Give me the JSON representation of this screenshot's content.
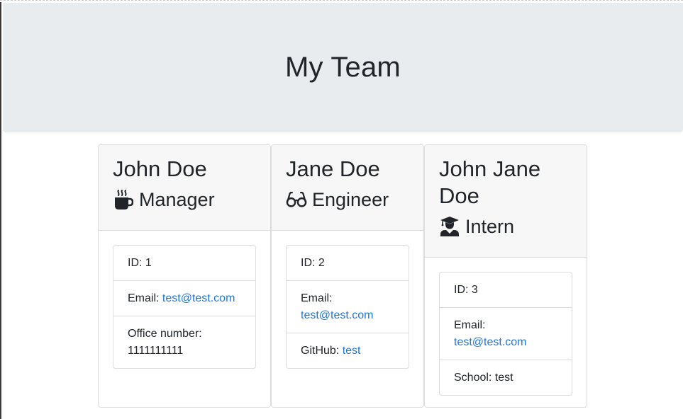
{
  "header": {
    "title": "My Team"
  },
  "employees": [
    {
      "name": "John Doe",
      "role": "Manager",
      "icon": "mug-hot-icon",
      "id_label": "ID:",
      "id_value": "1",
      "email_label": "Email:",
      "email": "test@test.com",
      "extra_label": "Office number:",
      "extra_value": "1111111111"
    },
    {
      "name": "Jane Doe",
      "role": "Engineer",
      "icon": "glasses-icon",
      "id_label": "ID:",
      "id_value": "2",
      "email_label": "Email:",
      "email": "test@test.com",
      "extra_label": "GitHub:",
      "extra_value": "test"
    },
    {
      "name": "John Jane Doe",
      "role": "Intern",
      "icon": "graduate-icon",
      "id_label": "ID:",
      "id_value": "3",
      "email_label": "Email:",
      "email": "test@test.com",
      "extra_label": "School:",
      "extra_value": "test"
    }
  ],
  "colors": {
    "jumbotron_bg": "#e9ecef",
    "card_header_bg": "#f7f7f7",
    "link": "#1f77e0",
    "text": "#212529"
  }
}
